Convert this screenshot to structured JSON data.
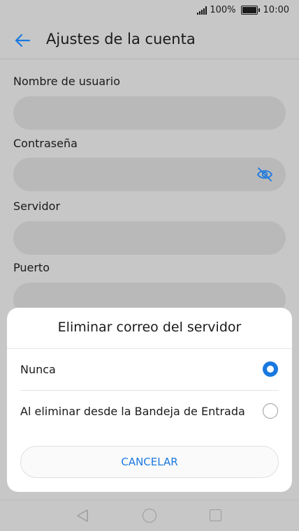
{
  "status_bar": {
    "battery_percent": "100%",
    "time": "10:00",
    "battery_level": 1.0
  },
  "app_bar": {
    "title": "Ajustes de la cuenta"
  },
  "form": {
    "username_label": "Nombre de usuario",
    "password_label": "Contraseña",
    "server_label": "Servidor",
    "port_label": "Puerto"
  },
  "dialog": {
    "title": "Eliminar correo del servidor",
    "options": [
      {
        "label": "Nunca",
        "selected": true
      },
      {
        "label": "Al eliminar desde la Bandeja de Entrada",
        "selected": false
      }
    ],
    "cancel_label": "CANCELAR"
  },
  "colors": {
    "accent": "#1a79e0",
    "overlay": "#c7c7c7",
    "field": "#b9b9b9"
  },
  "icons": [
    "back-arrow-icon",
    "eye-off-icon",
    "nav-back-icon",
    "nav-home-icon",
    "nav-recent-icon"
  ]
}
